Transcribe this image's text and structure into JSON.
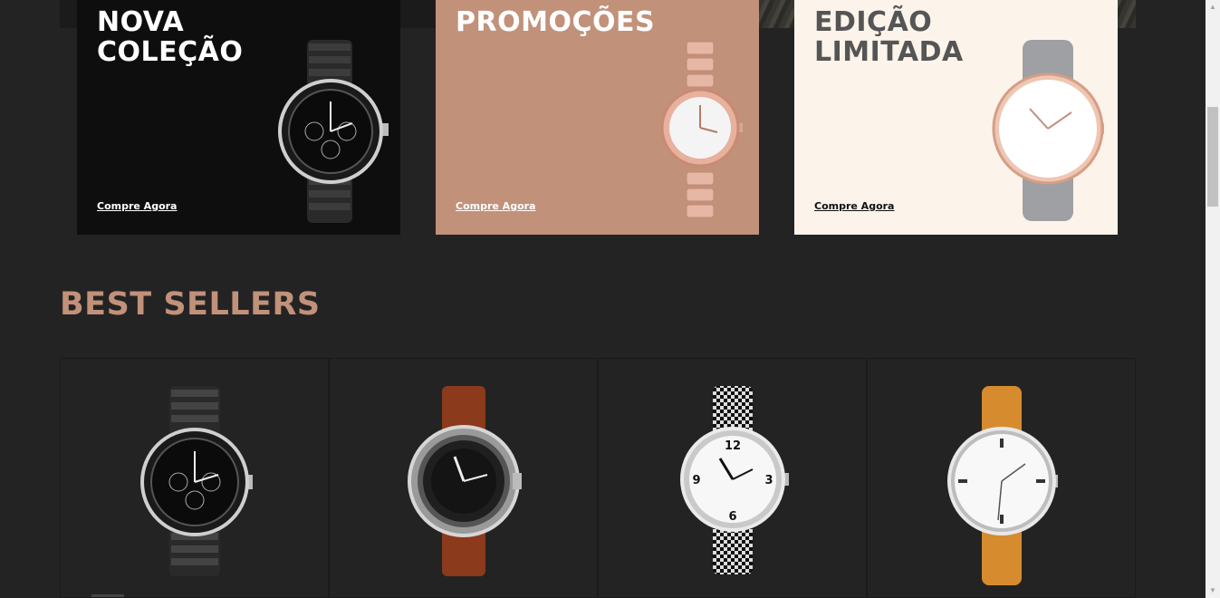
{
  "promos": [
    {
      "title": "NOVA\nCOLEÇÃO",
      "cta": "Compre Agora"
    },
    {
      "title": "PROMOÇÕES",
      "cta": "Compre Agora"
    },
    {
      "title": "EDIÇÃO\nLIMITADA",
      "cta": "Compre Agora"
    }
  ],
  "best_sellers": {
    "title": "BEST SELLERS",
    "products": [
      {
        "image": "black-chronograph-watch-icon"
      },
      {
        "image": "diver-watch-brown-strap-icon"
      },
      {
        "image": "timex-houndstooth-watch-icon"
      },
      {
        "image": "white-dial-tan-strap-watch-icon"
      }
    ]
  },
  "colors": {
    "background": "#232323",
    "accent": "#c1917a",
    "card_dark": "#0e0e0e",
    "card_cream": "#fcf4ea"
  }
}
